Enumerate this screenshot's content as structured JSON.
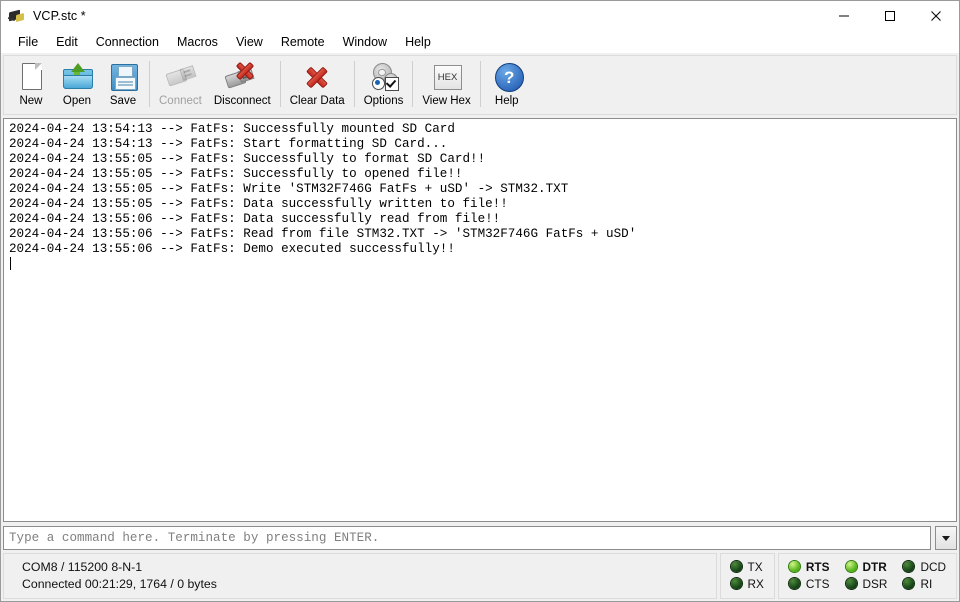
{
  "window": {
    "title": "VCP.stc *",
    "icon": "serial-plug-icon",
    "controls": {
      "minimize": "minimize-icon",
      "maximize": "maximize-icon",
      "close": "close-icon"
    }
  },
  "menu": {
    "items": [
      {
        "label": "File"
      },
      {
        "label": "Edit"
      },
      {
        "label": "Connection"
      },
      {
        "label": "Macros"
      },
      {
        "label": "View"
      },
      {
        "label": "Remote"
      },
      {
        "label": "Window"
      },
      {
        "label": "Help"
      }
    ]
  },
  "toolbar": {
    "buttons": [
      {
        "label": "New",
        "icon": "new-document-icon",
        "enabled": true
      },
      {
        "label": "Open",
        "icon": "open-folder-icon",
        "enabled": true
      },
      {
        "label": "Save",
        "icon": "save-floppy-icon",
        "enabled": true
      },
      {
        "label": "Connect",
        "icon": "usb-connect-icon",
        "enabled": false
      },
      {
        "label": "Disconnect",
        "icon": "usb-disconnect-icon",
        "enabled": true
      },
      {
        "label": "Clear Data",
        "icon": "red-x-icon",
        "enabled": true
      },
      {
        "label": "Options",
        "icon": "gears-options-icon",
        "enabled": true
      },
      {
        "label": "View Hex",
        "icon": "hex-icon",
        "enabled": true
      },
      {
        "label": "Help",
        "icon": "help-question-icon",
        "enabled": true
      }
    ],
    "hex_icon_text": "HEX",
    "help_icon_text": "?"
  },
  "terminal": {
    "lines": [
      "2024-04-24 13:54:13 --> FatFs: Successfully mounted SD Card",
      "2024-04-24 13:54:13 --> FatFs: Start formatting SD Card...",
      "2024-04-24 13:55:05 --> FatFs: Successfully to format SD Card!!",
      "2024-04-24 13:55:05 --> FatFs: Successfully to opened file!!",
      "2024-04-24 13:55:05 --> FatFs: Write 'STM32F746G FatFs + uSD' -> STM32.TXT",
      "2024-04-24 13:55:05 --> FatFs: Data successfully written to file!!",
      "2024-04-24 13:55:06 --> FatFs: Data successfully read from file!!",
      "2024-04-24 13:55:06 --> FatFs: Read from file STM32.TXT -> 'STM32F746G FatFs + uSD'",
      "2024-04-24 13:55:06 --> FatFs: Demo executed successfully!!"
    ],
    "text_color": "#000000",
    "background": "#ffffff"
  },
  "command": {
    "value": "",
    "placeholder": "Type a command here. Terminate by pressing ENTER.",
    "dropdown_icon": "chevron-down-icon"
  },
  "status": {
    "port_line": "COM8 / 115200 8-N-1",
    "connection_line": "Connected 00:21:29, 1764 / 0 bytes",
    "led_groups": [
      {
        "name": "data-leds",
        "leds": [
          {
            "label": "TX",
            "on": false
          },
          {
            "label": "RX",
            "on": false
          }
        ]
      },
      {
        "name": "signal-leds",
        "leds": [
          {
            "label": "RTS",
            "on": true
          },
          {
            "label": "CTS",
            "on": false
          },
          {
            "label": "DTR",
            "on": true
          },
          {
            "label": "DSR",
            "on": false
          },
          {
            "label": "DCD",
            "on": false
          },
          {
            "label": "RI",
            "on": false
          }
        ]
      }
    ],
    "colors": {
      "led_on": "#7ed321",
      "led_off": "#2d5a22"
    }
  }
}
